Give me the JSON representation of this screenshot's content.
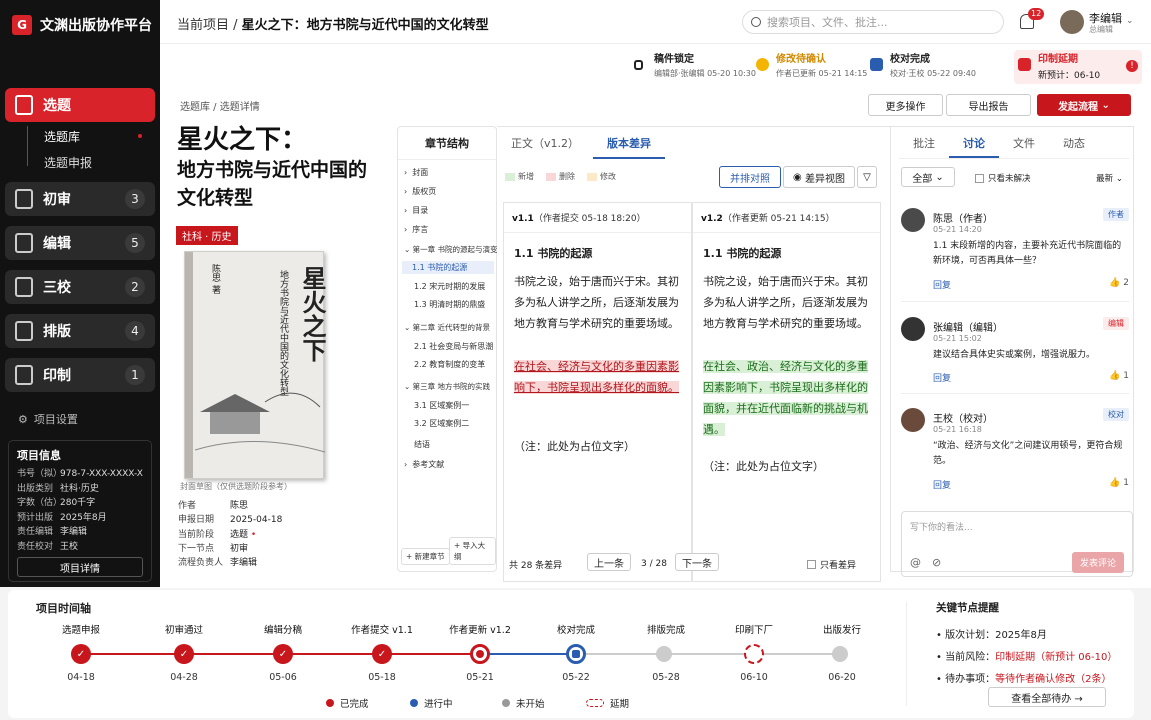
{
  "app": {
    "name": "文渊出版协作平台",
    "logo": "G"
  },
  "nav": [
    {
      "label": "选题",
      "badge": ""
    },
    {
      "label": "初审",
      "badge": "3"
    },
    {
      "label": "编辑",
      "badge": "5"
    },
    {
      "label": "三校",
      "badge": "2"
    },
    {
      "label": "排版",
      "badge": "4"
    },
    {
      "label": "印制",
      "badge": "1"
    }
  ],
  "subnav": [
    "选题库",
    "选题申报"
  ],
  "project_settings": "项目设置",
  "info": {
    "title": "项目信息",
    "rows": [
      [
        "书号（拟）",
        "978-7-XXX-XXXX-X"
      ],
      [
        "出版类别",
        "社科·历史"
      ],
      [
        "字数（估）",
        "280千字"
      ],
      [
        "预计出版",
        "2025年8月"
      ],
      [
        "责任编辑",
        "李编辑"
      ],
      [
        "责任校对",
        "王校"
      ]
    ],
    "button": "项目详情"
  },
  "top": {
    "crumb1": "当前项目",
    "crumb2": "星火之下：地方书院与近代中国的文化转型",
    "search_placeholder": "搜索项目、文件、批注...",
    "notif": "12",
    "user": "李编辑",
    "role": "总编辑"
  },
  "status": [
    {
      "t": "稿件锁定",
      "d": "编辑部·张编辑   05-20 10:30"
    },
    {
      "t": "修改待确认",
      "d": "作者已更新   05-21 14:15"
    },
    {
      "t": "校对完成",
      "d": "校对·王校   05-22 09:40"
    },
    {
      "t": "印制延期",
      "d": "新预计：06-10"
    }
  ],
  "bc2": "选题库 / 选题详情",
  "actions": {
    "more": "更多操作",
    "export": "导出报告",
    "start": "发起流程"
  },
  "book": {
    "title1": "星火之下：",
    "title2": "地方书院与近代中国的",
    "title3": "文化转型",
    "tag": "社科 · 历史",
    "cover_title": "星火之下",
    "cover_sub": "地方书院与近代中国的文化转型",
    "cover_author": "陈思 著",
    "cover_caption": "封面草图（仅供选题阶段参考）"
  },
  "meta": [
    [
      "作者",
      "陈思"
    ],
    [
      "申报日期",
      "2025-04-18"
    ],
    [
      "当前阶段",
      "选题"
    ],
    [
      "下一节点",
      "初审"
    ],
    [
      "流程负责人",
      "李编辑"
    ]
  ],
  "toc": {
    "title": "章节结构",
    "items": [
      "封面",
      "版权页",
      "目录",
      "序言",
      "第一章  书院的源起与演变",
      "1.1 书院的起源",
      "1.2 宋元时期的发展",
      "1.3 明清时期的鼎盛",
      "第二章  近代转型的背景",
      "2.1 社会变局与新思潮",
      "2.2 教育制度的变革",
      "第三章  地方书院的实践",
      "3.1 区域案例一",
      "3.2 区域案例二",
      "结语",
      "参考文献"
    ],
    "add": "+ 新建章节",
    "import": "+ 导入大纲"
  },
  "diff": {
    "tab1": "正文（v1.2）",
    "tab2": "版本差异",
    "leg": [
      "新增",
      "删除",
      "修改"
    ],
    "btn1": "并排对照",
    "btn2": "差异视图",
    "left": {
      "ver": "v1.1",
      "note": "（作者提交 05-18 18:20）",
      "h": "1.1 书院的起源",
      "p1": "书院之设，始于唐而兴于宋。其初多为私人讲学之所，后逐渐发展为地方教育与学术研究的重要场域。",
      "p2": "在社会、经济与文化的多重因素影响下，书院呈现出多样化的面貌。",
      "p3": "（注：此处为占位文字）"
    },
    "right": {
      "ver": "v1.2",
      "note": "（作者更新 05-21 14:15）",
      "h": "1.1 书院的起源",
      "p1": "书院之设，始于唐而兴于宋。其初多为私人讲学之所，后逐渐发展为地方教育与学术研究的重要场域。",
      "p2": "在社会、政治、经济与文化的多重因素影响下，书院呈现出多样化的面貌，并在近代面临新的挑战与机遇。",
      "p3": "（注：此处为占位文字）"
    },
    "count": "共 28 条差异",
    "prev": "上一条",
    "page": "3 / 28",
    "next": "下一条",
    "only": "只看差异"
  },
  "rp": {
    "tabs": [
      "批注",
      "讨论",
      "文件",
      "动态"
    ],
    "filter": "全部",
    "unresolved": "只看未解决",
    "sort": "最新",
    "comments": [
      {
        "name": "陈思（作者）",
        "time": "05-21 14:20",
        "role": "作者",
        "body": "1.1 末段新增的内容，主要补充近代书院面临的新环境，可否再具体一些？",
        "reply": "回复",
        "likes": "2"
      },
      {
        "name": "张编辑（编辑）",
        "time": "05-21 15:02",
        "role": "编辑",
        "body": "建议结合具体史实或案例，增强说服力。",
        "reply": "回复",
        "likes": "1"
      },
      {
        "name": "王校（校对）",
        "time": "05-21 16:18",
        "role": "校对",
        "body": "“政治、经济与文化”之间建议用顿号，更符合规范。",
        "reply": "回复",
        "likes": "1"
      }
    ],
    "compose_ph": "写下你的看法...",
    "send": "发表评论"
  },
  "timeline": {
    "title": "项目时间轴",
    "steps": [
      [
        "选题申报",
        "04-18"
      ],
      [
        "初审通过",
        "04-28"
      ],
      [
        "编辑分稿",
        "05-06"
      ],
      [
        "作者提交 v1.1",
        "05-18"
      ],
      [
        "作者更新 v1.2",
        "05-21"
      ],
      [
        "校对完成",
        "05-22"
      ],
      [
        "排版完成",
        "05-28"
      ],
      [
        "印刷下厂",
        "06-10"
      ],
      [
        "出版发行",
        "06-20"
      ]
    ],
    "legend": [
      "已完成",
      "进行中",
      "未开始",
      "延期"
    ]
  },
  "key": {
    "title": "关键节点提醒",
    "l1": "• 版次计划：",
    "v1": "2025年8月",
    "l2": "• 当前风险：",
    "v2": "印制延期（新预计 06-10）",
    "l3": "• 待办事项：",
    "v3": "等待作者确认修改（2条）",
    "btn": "查看全部待办  →"
  },
  "colors": {
    "brand": "#d8232a",
    "accent": "#2a5db0"
  }
}
